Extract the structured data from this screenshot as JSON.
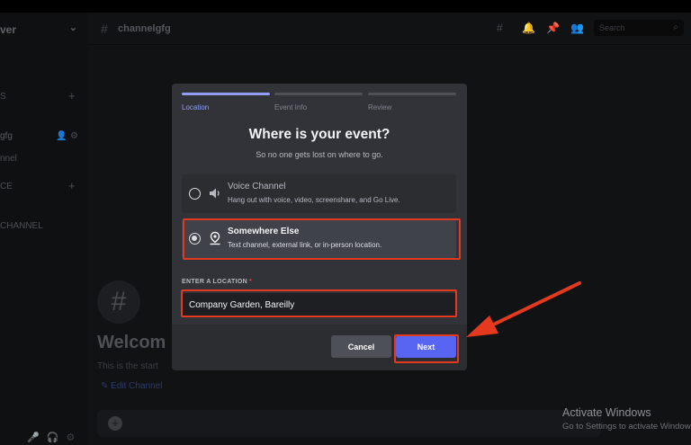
{
  "background": {
    "server_name": "ver",
    "channel_name": "channelgfg",
    "sidebar_fragments": [
      "S",
      "gfg",
      "nnel",
      "CE",
      "CHANNEL"
    ],
    "search_placeholder": "Search",
    "welcome": "Welcom",
    "welcome_sub": "This is the start",
    "edit_channel": "Edit Channel"
  },
  "modal": {
    "steps": [
      {
        "label": "Location",
        "active": true
      },
      {
        "label": "Event Info",
        "active": false
      },
      {
        "label": "Review",
        "active": false
      }
    ],
    "title": "Where is your event?",
    "subtitle": "So no one gets lost on where to go.",
    "options": [
      {
        "title": "Voice Channel",
        "description": "Hang out with voice, video, screenshare, and Go Live.",
        "icon": "speaker-icon",
        "selected": false
      },
      {
        "title": "Somewhere Else",
        "description": "Text channel, external link, or in-person location.",
        "icon": "location-pin-icon",
        "selected": true
      }
    ],
    "location_label": "ENTER A LOCATION",
    "required_mark": "*",
    "location_value": "Company Garden, Bareilly",
    "cancel_label": "Cancel",
    "next_label": "Next"
  },
  "watermark": {
    "title": "Activate Windows",
    "subtitle": "Go to Settings to activate Windows."
  },
  "colors": {
    "accent": "#5865f2",
    "step_active": "#949cf7",
    "highlight": "#e33a1f",
    "modal_bg": "#313338"
  }
}
